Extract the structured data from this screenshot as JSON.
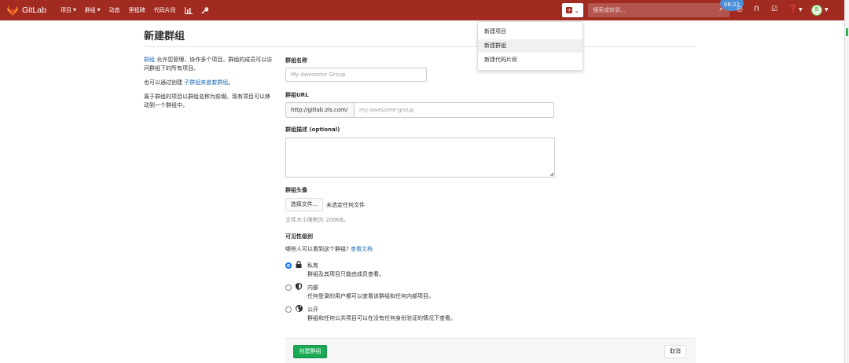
{
  "navbar": {
    "brand": "GitLab",
    "links": [
      "项目",
      "群组",
      "动态",
      "里程碑",
      "代码片段"
    ],
    "search_placeholder": "搜索或转到...",
    "clock": "08:22",
    "plus_caret": "⌄",
    "avatar": "页"
  },
  "page": {
    "title": "新建群组",
    "help": {
      "p1_link": "群组",
      "p1_text": "允许您管理、协作多个项目。群组的成员可以访问群组下的所有项目。",
      "p2_text": "也可以通过创建",
      "p2_link": "子群组来嵌套群组",
      "p2_end": "。",
      "p3_text": "属于群组的项目以群组名称为前缀。现有项目可以移动到一个群组中。"
    }
  },
  "form": {
    "name_label": "群组名称",
    "name_placeholder": "My Awesome Group",
    "url_label": "群组URL",
    "url_prefix": "http://gitlab.zls.com/",
    "url_placeholder": "my-awesome-group",
    "desc_label": "群组描述 (optional)",
    "avatar_label": "群组头像",
    "file_button": "选择文件...",
    "file_status": "未选定任何文件",
    "file_hint": "文件大小限制为 200KB。",
    "visibility_label": "可见性级别",
    "visibility_question": "哪些人可以看到这个群组?",
    "visibility_link": "查看文档",
    "options": [
      {
        "title": "私有",
        "desc": "群组及其项目只能由成员查看。",
        "checked": true
      },
      {
        "title": "内部",
        "desc": "任何登录的用户都可以查看该群组和任何内部项目。",
        "checked": false
      },
      {
        "title": "公开",
        "desc": "群组和任何公共项目可以在没有任何身份验证的情况下查看。",
        "checked": false
      }
    ],
    "create_button": "创建群组",
    "cancel_button": "取消"
  },
  "dropdown": {
    "items": [
      "新建项目",
      "新建群组",
      "新建代码片段"
    ],
    "active_index": 1
  },
  "colors": {
    "navbar": "#a12a21",
    "link": "#1b69b6",
    "create_button": "#1aaa55",
    "radio_checked": "#1a73e8"
  }
}
